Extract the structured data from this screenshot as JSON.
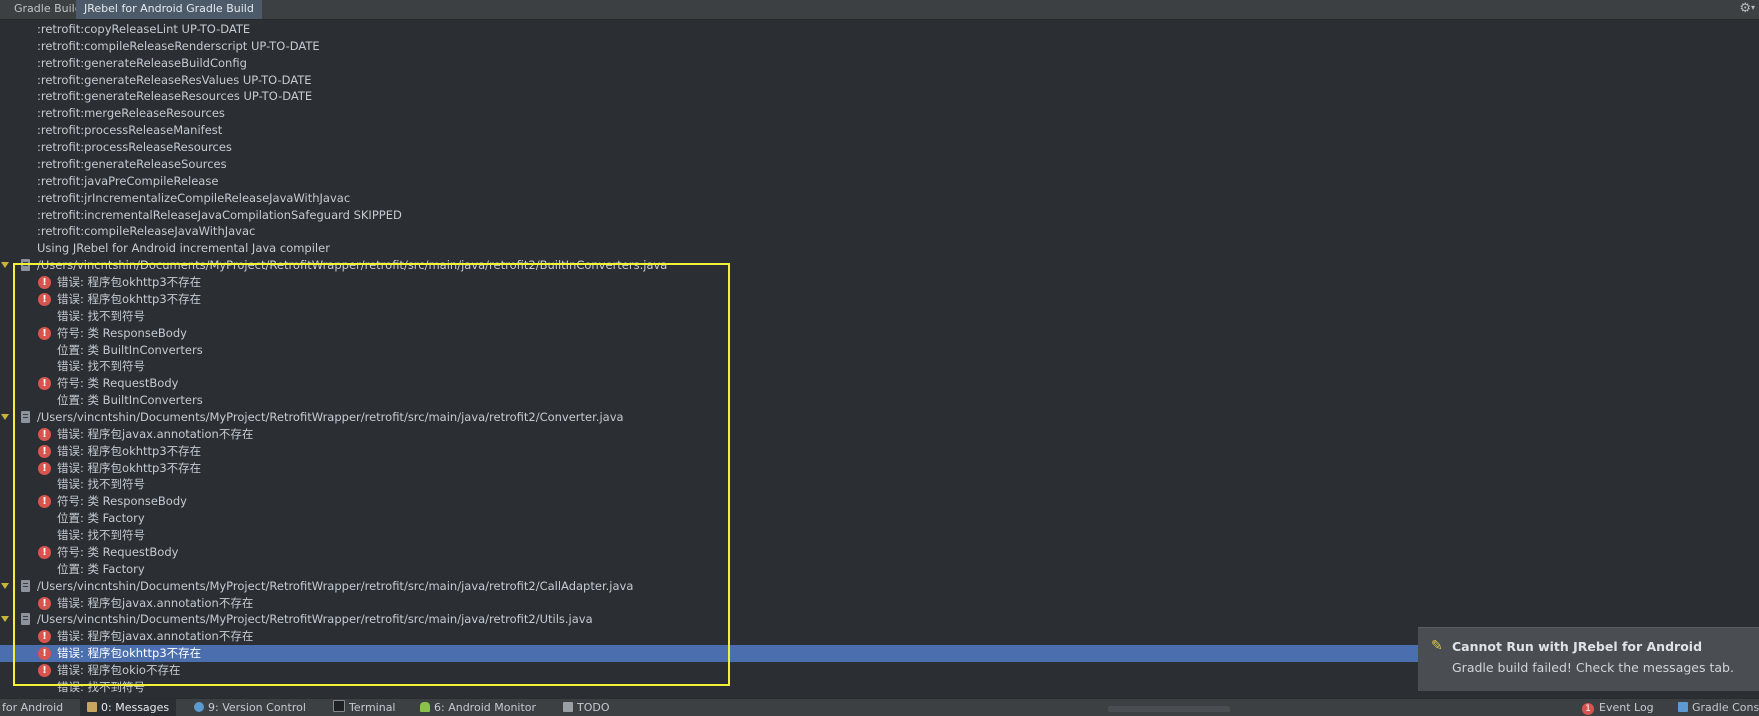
{
  "tabs": [
    {
      "label": "Gradle Build",
      "active": false
    },
    {
      "label": "JRebel for Android Gradle Build",
      "active": true
    }
  ],
  "toolbar": {
    "settings_icon": "gear-icon"
  },
  "log_lines": [
    {
      "type": "text",
      "text": ":retrofit:copyReleaseLint UP-TO-DATE"
    },
    {
      "type": "text",
      "text": ":retrofit:compileReleaseRenderscript UP-TO-DATE"
    },
    {
      "type": "text",
      "text": ":retrofit:generateReleaseBuildConfig"
    },
    {
      "type": "text",
      "text": ":retrofit:generateReleaseResValues UP-TO-DATE"
    },
    {
      "type": "text",
      "text": ":retrofit:generateReleaseResources UP-TO-DATE"
    },
    {
      "type": "text",
      "text": ":retrofit:mergeReleaseResources"
    },
    {
      "type": "text",
      "text": ":retrofit:processReleaseManifest"
    },
    {
      "type": "text",
      "text": ":retrofit:processReleaseResources"
    },
    {
      "type": "text",
      "text": ":retrofit:generateReleaseSources"
    },
    {
      "type": "text",
      "text": ":retrofit:javaPreCompileRelease"
    },
    {
      "type": "text",
      "text": ":retrofit:jrIncrementalizeCompileReleaseJavaWithJavac"
    },
    {
      "type": "text",
      "text": ":retrofit:incrementalReleaseJavaCompilationSafeguard SKIPPED"
    },
    {
      "type": "text",
      "text": ":retrofit:compileReleaseJavaWithJavac"
    },
    {
      "type": "text",
      "text": "Using JRebel for Android incremental Java compiler"
    },
    {
      "type": "file",
      "text": "/Users/vincntshin/Documents/MyProject/RetrofitWrapper/retrofit/src/main/java/retrofit2/BuiltInConverters.java"
    },
    {
      "type": "error",
      "text": "错误: 程序包okhttp3不存在"
    },
    {
      "type": "error",
      "text": "错误: 程序包okhttp3不存在"
    },
    {
      "type": "detail",
      "text": "错误: 找不到符号"
    },
    {
      "type": "error",
      "text": "符号:   类 ResponseBody"
    },
    {
      "type": "detail",
      "text": "位置: 类 BuiltInConverters"
    },
    {
      "type": "detail",
      "text": "错误: 找不到符号"
    },
    {
      "type": "error",
      "text": "符号:   类 RequestBody"
    },
    {
      "type": "detail",
      "text": "位置: 类 BuiltInConverters"
    },
    {
      "type": "file",
      "text": "/Users/vincntshin/Documents/MyProject/RetrofitWrapper/retrofit/src/main/java/retrofit2/Converter.java"
    },
    {
      "type": "error",
      "text": "错误: 程序包javax.annotation不存在"
    },
    {
      "type": "error",
      "text": "错误: 程序包okhttp3不存在"
    },
    {
      "type": "error",
      "text": "错误: 程序包okhttp3不存在"
    },
    {
      "type": "detail",
      "text": "错误: 找不到符号"
    },
    {
      "type": "error",
      "text": "符号:   类 ResponseBody"
    },
    {
      "type": "detail",
      "text": "位置: 类 Factory"
    },
    {
      "type": "detail",
      "text": "错误: 找不到符号"
    },
    {
      "type": "error",
      "text": "符号:   类 RequestBody"
    },
    {
      "type": "detail",
      "text": "位置: 类 Factory"
    },
    {
      "type": "file",
      "text": "/Users/vincntshin/Documents/MyProject/RetrofitWrapper/retrofit/src/main/java/retrofit2/CallAdapter.java"
    },
    {
      "type": "error",
      "text": "错误: 程序包javax.annotation不存在"
    },
    {
      "type": "file",
      "text": "/Users/vincntshin/Documents/MyProject/RetrofitWrapper/retrofit/src/main/java/retrofit2/Utils.java"
    },
    {
      "type": "error",
      "text": "错误: 程序包javax.annotation不存在"
    },
    {
      "type": "error",
      "text": "错误: 程序包okhttp3不存在",
      "selected": true
    },
    {
      "type": "error",
      "text": "错误: 程序包okio不存在"
    },
    {
      "type": "detail",
      "text": "错误: 找不到符号"
    }
  ],
  "notification": {
    "title": "Cannot Run with JRebel for Android",
    "message": "Gradle build failed! Check the messages tab."
  },
  "statusbar": {
    "items": [
      {
        "label": "for Android",
        "icon": "",
        "active": false
      },
      {
        "label": "0: Messages",
        "icon": "messages-icon",
        "active": true
      },
      {
        "label": "9: Version Control",
        "icon": "version-control-icon",
        "active": false
      },
      {
        "label": "Terminal",
        "icon": "terminal-icon",
        "active": false
      },
      {
        "label": "6: Android Monitor",
        "icon": "android-icon",
        "active": false
      },
      {
        "label": "TODO",
        "icon": "todo-icon",
        "active": false
      }
    ],
    "event_log": {
      "count": "1",
      "label": "Event Log"
    },
    "gradle_console": {
      "label": "Gradle Cons"
    }
  },
  "colors": {
    "background": "#2b2f33",
    "selection": "#4b6eaf",
    "error": "#d9534f",
    "highlight_box": "#f2f039"
  }
}
